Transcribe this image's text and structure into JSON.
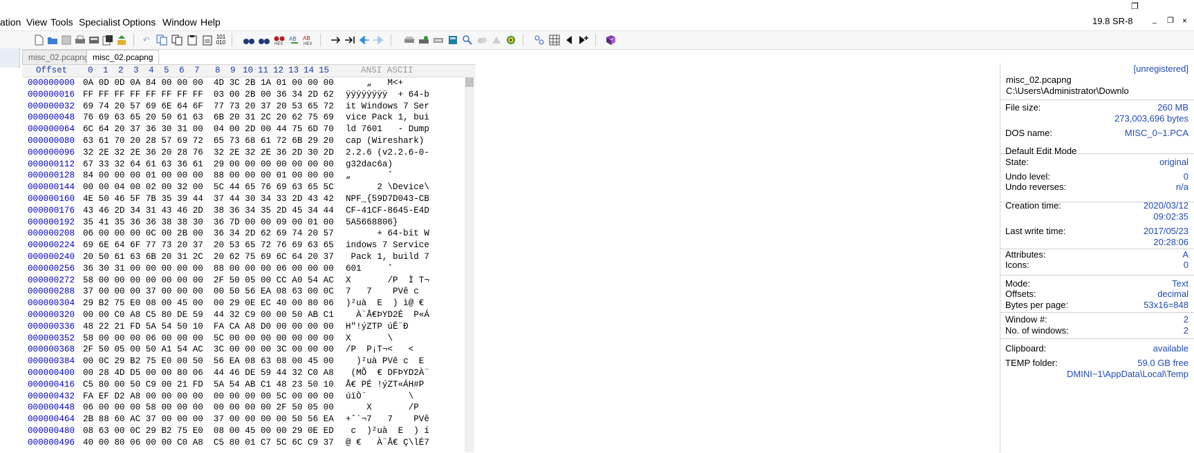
{
  "menu": {
    "items": [
      "ation",
      "View",
      "Tools",
      "Specialist",
      "Options",
      "Window",
      "Help"
    ],
    "version": "19.8 SR-8",
    "window_controls": [
      "_",
      "❐",
      "×"
    ]
  },
  "toolbar": {
    "icons": [
      "new-file-icon",
      "open-file-icon",
      "save-icon",
      "print-icon",
      "properties-icon",
      "save-all-icon",
      "export-icon",
      "undo-icon",
      "cut-icon",
      "copy-icon",
      "paste-icon",
      "paste-write-icon",
      "clipboard-hex-icon",
      "find-icon",
      "find-hex-icon",
      "find-text-icon",
      "replace-icon",
      "replace-hex-icon",
      "goto-offset-icon",
      "goto-mark-icon",
      "back-icon",
      "forward-icon",
      "disk-icon",
      "disk-open-icon",
      "ram-icon",
      "calculator-icon",
      "search-disk-icon",
      "cloud-icon",
      "shortcut-icon",
      "settings-icon",
      "view-mode-icon",
      "grid-icon",
      "arrow-left-icon",
      "arrow-plus-icon",
      "book-icon"
    ]
  },
  "tabs": [
    "misc_02.pcapng",
    "misc_02.pcapng"
  ],
  "hex_header": {
    "offset": "Offset",
    "columns": [
      "0",
      "1",
      "2",
      "3",
      "4",
      "5",
      "6",
      "7",
      "8",
      "9",
      "10",
      "11",
      "12",
      "13",
      "14",
      "15"
    ],
    "ascii": "ANSI ASCII"
  },
  "rows": [
    {
      "offset": "000000000",
      "hex": "0A 0D 0D 0A 84 00 00 00  4D 3C 2B 1A 01 00 00 00",
      "ascii": "    „   M<+"
    },
    {
      "offset": "000000016",
      "hex": "FF FF FF FF FF FF FF FF  03 00 2B 00 36 34 2D 62",
      "ascii": "ÿÿÿÿÿÿÿÿ  + 64-b"
    },
    {
      "offset": "000000032",
      "hex": "69 74 20 57 69 6E 64 6F  77 73 20 37 20 53 65 72",
      "ascii": "it Windows 7 Ser"
    },
    {
      "offset": "000000048",
      "hex": "76 69 63 65 20 50 61 63  6B 20 31 2C 20 62 75 69",
      "ascii": "vice Pack 1, bui"
    },
    {
      "offset": "000000064",
      "hex": "6C 64 20 37 36 30 31 00  04 00 2D 00 44 75 6D 70",
      "ascii": "ld 7601   - Dump"
    },
    {
      "offset": "000000080",
      "hex": "63 61 70 20 28 57 69 72  65 73 68 61 72 6B 29 20",
      "ascii": "cap (Wireshark) "
    },
    {
      "offset": "000000096",
      "hex": "32 2E 32 2E 36 20 28 76  32 2E 32 2E 36 2D 30 2D",
      "ascii": "2.2.6 (v2.2.6-0-"
    },
    {
      "offset": "000000112",
      "hex": "67 33 32 64 61 63 36 61  29 00 00 00 00 00 00 00",
      "ascii": "g32dac6a)"
    },
    {
      "offset": "000000128",
      "hex": "84 00 00 00 01 00 00 00  88 00 00 00 01 00 00 00",
      "ascii": "„       ˆ"
    },
    {
      "offset": "000000144",
      "hex": "00 00 04 00 02 00 32 00  5C 44 65 76 69 63 65 5C",
      "ascii": "      2 \\Device\\"
    },
    {
      "offset": "000000160",
      "hex": "4E 50 46 5F 7B 35 39 44  37 44 30 34 33 2D 43 42",
      "ascii": "NPF_{59D7D043-CB"
    },
    {
      "offset": "000000176",
      "hex": "43 46 2D 34 31 43 46 2D  38 36 34 35 2D 45 34 44",
      "ascii": "CF-41CF-8645-E4D"
    },
    {
      "offset": "000000192",
      "hex": "35 41 35 36 36 38 38 30  36 7D 00 00 09 00 01 00",
      "ascii": "5A5668806}"
    },
    {
      "offset": "000000208",
      "hex": "06 00 00 00 0C 00 2B 00  36 34 2D 62 69 74 20 57",
      "ascii": "      + 64-bit W"
    },
    {
      "offset": "000000224",
      "hex": "69 6E 64 6F 77 73 20 37  20 53 65 72 76 69 63 65",
      "ascii": "indows 7 Service"
    },
    {
      "offset": "000000240",
      "hex": "20 50 61 63 6B 20 31 2C  20 62 75 69 6C 64 20 37",
      "ascii": " Pack 1, build 7"
    },
    {
      "offset": "000000256",
      "hex": "36 30 31 00 00 00 00 00  88 00 00 00 06 00 00 00",
      "ascii": "601     ˆ"
    },
    {
      "offset": "000000272",
      "hex": "58 00 00 00 00 00 00 00  2F 50 05 00 CC A0 54 AC",
      "ascii": "X       /P  Ì T¬"
    },
    {
      "offset": "000000288",
      "hex": "37 00 00 00 37 00 00 00  00 50 56 EA 08 63 00 0C",
      "ascii": "7   7    PVê c"
    },
    {
      "offset": "000000304",
      "hex": "29 B2 75 E0 08 00 45 00  00 29 0E EC 40 00 80 06",
      "ascii": ")²uà  E  ) ì@ €"
    },
    {
      "offset": "000000320",
      "hex": "00 00 C0 A8 C5 80 DE 59  44 32 C9 00 00 50 AB C1",
      "ascii": "  À¨Å€ÞYD2É  P«Á"
    },
    {
      "offset": "000000336",
      "hex": "48 22 21 FD 5A 54 50 10  FA CA A8 D0 00 00 00 00",
      "ascii": "H\"!ýZTP úÊ¨Ð"
    },
    {
      "offset": "000000352",
      "hex": "58 00 00 00 06 00 00 00  5C 00 00 00 00 00 00 00",
      "ascii": "X       \\"
    },
    {
      "offset": "000000368",
      "hex": "2F 50 05 00 50 A1 54 AC  3C 00 00 00 3C 00 00 00",
      "ascii": "/P  P¡T¬<   <"
    },
    {
      "offset": "000000384",
      "hex": "00 0C 29 B2 75 E0 00 50  56 EA 08 63 08 00 45 00",
      "ascii": "  )²uà PVê c  E"
    },
    {
      "offset": "000000400",
      "hex": "00 28 4D D5 00 00 80 06  44 46 DE 59 44 32 C0 A8",
      "ascii": " (MÕ  € DFÞYD2À¨"
    },
    {
      "offset": "000000416",
      "hex": "C5 80 00 50 C9 00 21 FD  5A 54 AB C1 48 23 50 10",
      "ascii": "Å€ PÉ !ýZT«ÁH#P"
    },
    {
      "offset": "000000432",
      "hex": "FA EF D2 A8 00 00 00 00  00 00 00 00 5C 00 00 00",
      "ascii": "úïÒ¨        \\"
    },
    {
      "offset": "000000448",
      "hex": "06 00 00 00 58 00 00 00  00 00 00 00 2F 50 05 00",
      "ascii": "    X       /P"
    },
    {
      "offset": "000000464",
      "hex": "2B 88 60 AC 37 00 00 00  37 00 00 00 00 50 56 EA",
      "ascii": "+ˆ`¬7   7    PVê"
    },
    {
      "offset": "000000480",
      "hex": "08 63 00 0C 29 B2 75 E0  08 00 45 00 00 29 0E ED",
      "ascii": " c  )²uà  E  ) í"
    },
    {
      "offset": "000000496",
      "hex": "40 00 80 06 00 00 C0 A8  C5 80 01 C7 5C 6C C9 37",
      "ascii": "@ €   À¨Å€ Ç\\lÉ7"
    }
  ],
  "info": {
    "registration": "[unregistered]",
    "filename": "misc_02.pcapng",
    "path": "C:\\Users\\Administrator\\Downlo",
    "file_size_label": "File size:",
    "file_size": "260 MB",
    "file_bytes": "273,003,696 bytes",
    "dos_label": "DOS name:",
    "dos_name": "MISC_0~1.PCA",
    "edit_mode": "Default Edit Mode",
    "state_label": "State:",
    "state": "original",
    "undo_label": "Undo level:",
    "undo": "0",
    "undo_rev_label": "Undo reverses:",
    "undo_rev": "n/a",
    "creation_label": "Creation time:",
    "creation_date": "2020/03/12",
    "creation_time": "09:02:35",
    "write_label": "Last write time:",
    "write_date": "2017/05/23",
    "write_time": "20:28:06",
    "attr_label": "Attributes:",
    "attr": "A",
    "icons_label": "Icons:",
    "icons": "0",
    "mode_label": "Mode:",
    "mode": "Text",
    "offsets_label": "Offsets:",
    "offsets": "decimal",
    "bpp_label": "Bytes per page:",
    "bpp": "53x16=848",
    "win_label": "Window #:",
    "win": "2",
    "nwin_label": "No. of windows:",
    "nwin": "2",
    "clip_label": "Clipboard:",
    "clip": "available",
    "temp_label": "TEMP folder:",
    "temp": "59.0 GB free",
    "temp_path": "DMINI~1\\AppData\\Local\\Temp"
  }
}
